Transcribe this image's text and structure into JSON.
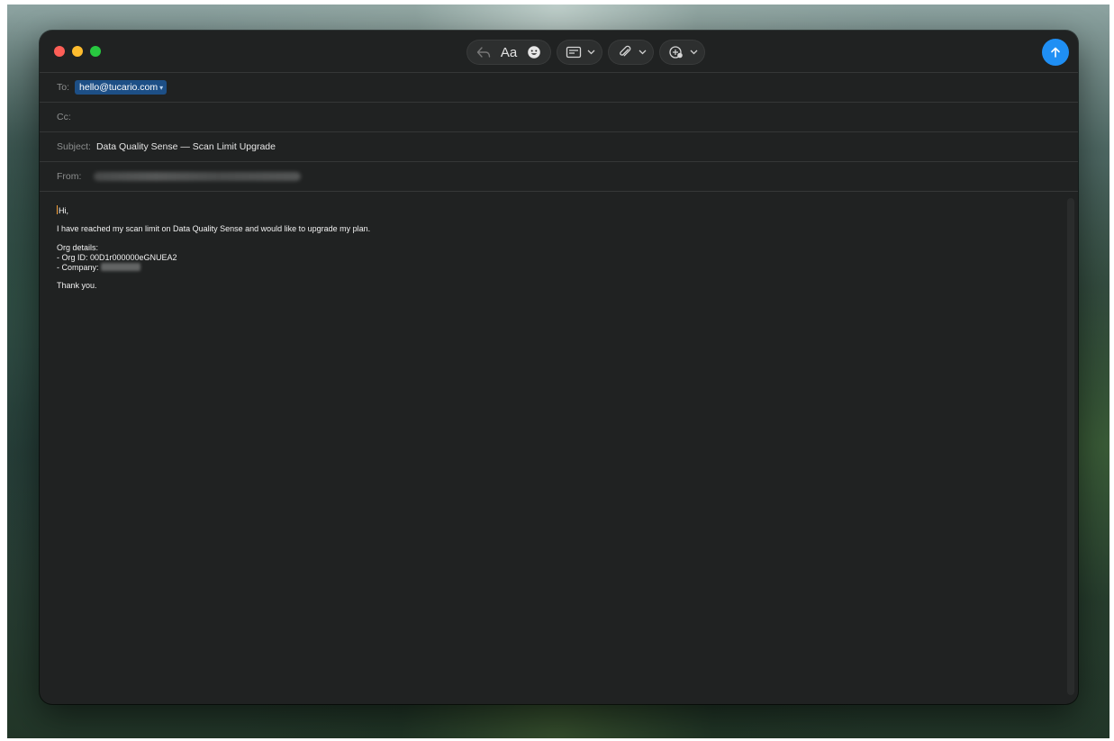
{
  "compose": {
    "to_label": "To:",
    "to_value": "hello@tucario.com",
    "cc_label": "Cc:",
    "subject_label": "Subject:",
    "subject_value": "Data Quality Sense — Scan Limit Upgrade",
    "from_label": "From:",
    "aa_label": "Aa"
  },
  "body": {
    "greeting": "Hi,",
    "line1": "I have reached my scan limit on Data Quality Sense and would like to upgrade my plan.",
    "org_heading": "Org details:",
    "org_id": "- Org ID: 00D1r000000eGNUEA2",
    "company_label": "- Company:",
    "closing": "Thank you."
  },
  "colors": {
    "send_button": "#1f8ff4",
    "recipient_chip": "#1d4f86",
    "window_bg": "#202222"
  },
  "icons": {
    "reply": "reply-arrow-icon",
    "emoji": "emoji-icon",
    "header_fields": "header-fields-icon",
    "attach": "paperclip-icon",
    "markup": "photo-browser-icon",
    "send": "send-arrow-icon"
  }
}
